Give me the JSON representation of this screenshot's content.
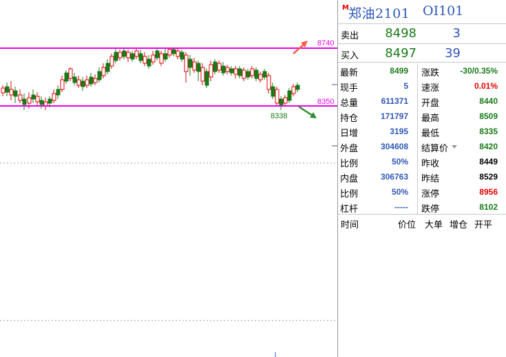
{
  "chart": {
    "upper_line_label": "8740",
    "lower_line_label": "8350",
    "low_point_label": "8338",
    "line_color": "#e800e8",
    "up_color": "#e00000",
    "down_color": "#197a19"
  },
  "header": {
    "marker": "M",
    "title": "郑油2101",
    "code": "OI101"
  },
  "quote": {
    "ask": {
      "label": "卖出",
      "price": "8498",
      "volume": "3"
    },
    "bid": {
      "label": "买入",
      "price": "8497",
      "volume": "39"
    }
  },
  "stats": [
    {
      "l1": "最新",
      "v1": "8499",
      "c1": "green",
      "l2": "涨跌",
      "v2": "-30/0.35%",
      "c2": "green"
    },
    {
      "l1": "现手",
      "v1": "5",
      "c1": "blue",
      "l2": "速涨",
      "v2": "0.01%",
      "c2": "red"
    },
    {
      "l1": "总量",
      "v1": "611371",
      "c1": "blue",
      "l2": "开盘",
      "v2": "8440",
      "c2": "green"
    },
    {
      "l1": "持仓",
      "v1": "171797",
      "c1": "blue",
      "l2": "最高",
      "v2": "8509",
      "c2": "green"
    },
    {
      "l1": "日增",
      "v1": "3195",
      "c1": "blue",
      "l2": "最低",
      "v2": "8335",
      "c2": "green"
    },
    {
      "l1": "外盘",
      "v1": "304608",
      "c1": "blue",
      "l2": "结算价",
      "v2": "8420",
      "c2": "green"
    },
    {
      "l1": "比例",
      "v1": "50%",
      "c1": "blue",
      "l2": "昨收",
      "v2": "8449",
      "c2": "black"
    },
    {
      "l1": "内盘",
      "v1": "306763",
      "c1": "blue",
      "l2": "昨结",
      "v2": "8529",
      "c2": "black"
    },
    {
      "l1": "比例",
      "v1": "50%",
      "c1": "blue",
      "l2": "涨停",
      "v2": "8956",
      "c2": "red"
    },
    {
      "l1": "杠杆",
      "v1": "-----",
      "c1": "blue",
      "l2": "跌停",
      "v2": "8102",
      "c2": "green"
    }
  ],
  "trades_header": {
    "time": "时间",
    "price": "价位",
    "big": "大单",
    "oi_change": "增仓",
    "open_close": "开平"
  }
}
